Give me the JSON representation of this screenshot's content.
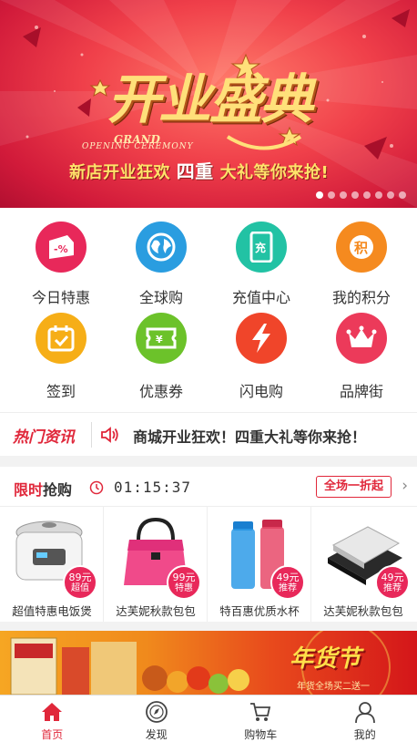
{
  "banner": {
    "title": "开业盛典",
    "grand": "GRAND",
    "ceremony": "OPENING CEREMONY",
    "subtitle_a": "新店开业狂欢",
    "subtitle_b": "四重",
    "subtitle_c": "大礼等你来抢!",
    "dot_count": 8,
    "active_dot": 0
  },
  "grid": {
    "items": [
      {
        "label": "今日特惠",
        "icon": "discount-tag-icon",
        "color": "#e8285a"
      },
      {
        "label": "全球购",
        "icon": "globe-icon",
        "color": "#2a9de0"
      },
      {
        "label": "充值中心",
        "icon": "phone-recharge-icon",
        "color": "#22c2a4"
      },
      {
        "label": "我的积分",
        "icon": "points-icon",
        "color": "#f58a1f"
      },
      {
        "label": "签到",
        "icon": "calendar-check-icon",
        "color": "#f6ae17"
      },
      {
        "label": "优惠券",
        "icon": "coupon-icon",
        "color": "#6cc22a"
      },
      {
        "label": "闪电购",
        "icon": "lightning-icon",
        "color": "#f0452a"
      },
      {
        "label": "品牌街",
        "icon": "crown-icon",
        "color": "#ec3a5a"
      }
    ]
  },
  "news": {
    "tag": "热门资讯",
    "text": "商城开业狂欢！四重大礼等你来抢！"
  },
  "flash": {
    "title_red": "限时",
    "title_rest": "抢购",
    "countdown": "01:15:37",
    "more": "全场一折起",
    "products": [
      {
        "name": "超值特惠电饭煲",
        "price": "89元",
        "tag": "超值"
      },
      {
        "name": "达芙妮秋款包包",
        "price": "99元",
        "tag": "特惠"
      },
      {
        "name": "特百惠优质水杯",
        "price": "49元",
        "tag": "推荐"
      },
      {
        "name": "达芙妮秋款包包",
        "price": "49元",
        "tag": "推荐"
      }
    ]
  },
  "promo": {
    "title": "年货节",
    "subtitle": "年货全场买二送一"
  },
  "nav": {
    "items": [
      {
        "label": "首页",
        "icon": "home-icon",
        "active": true
      },
      {
        "label": "发现",
        "icon": "compass-icon",
        "active": false
      },
      {
        "label": "购物车",
        "icon": "cart-icon",
        "active": false
      },
      {
        "label": "我的",
        "icon": "user-icon",
        "active": false
      }
    ]
  }
}
